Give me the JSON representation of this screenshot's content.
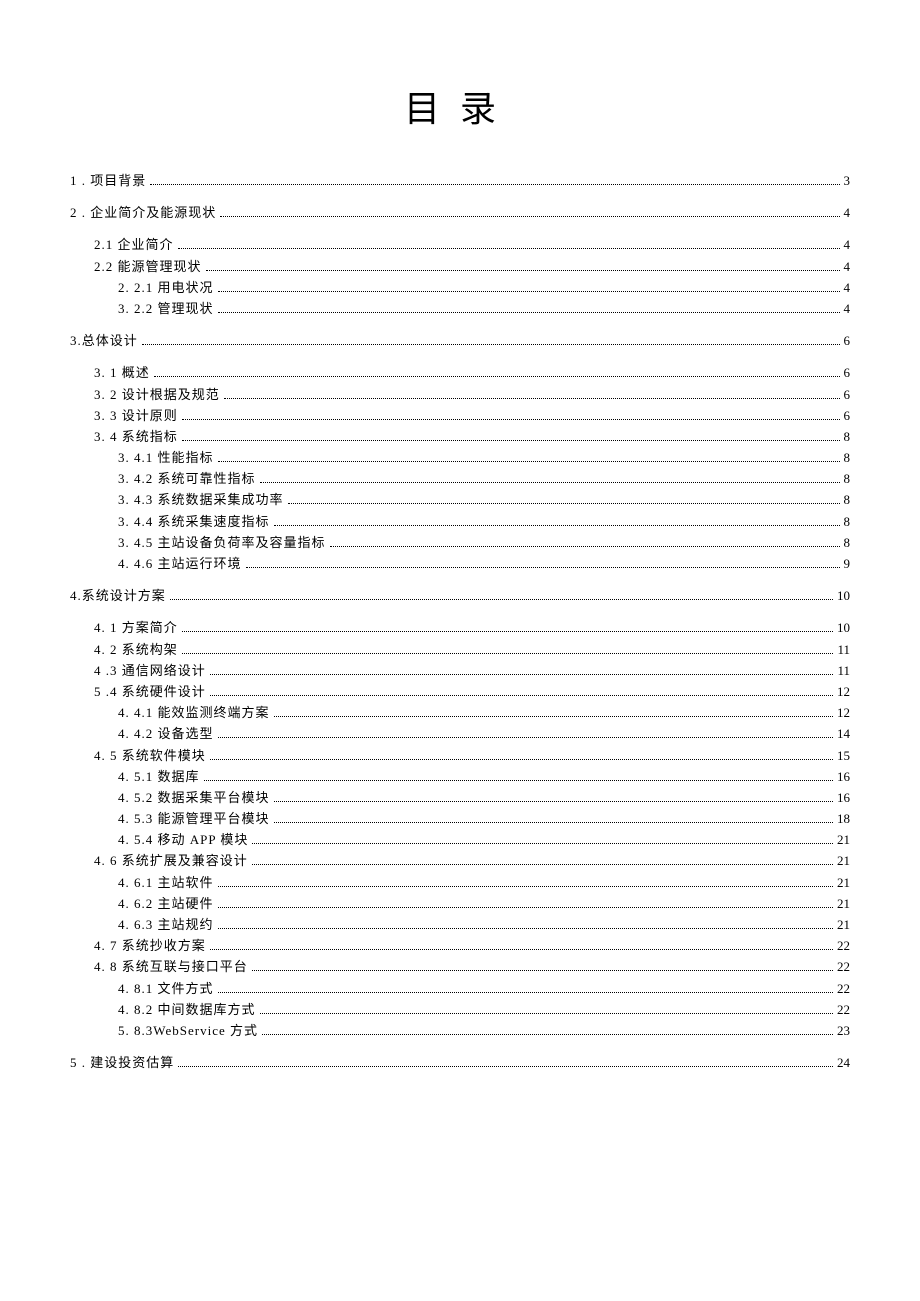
{
  "title": "目录",
  "entries": [
    {
      "level": 1,
      "label": "1   . 项目背景",
      "page": "3"
    },
    {
      "level": 1,
      "label": "2   . 企业简介及能源现状",
      "page": "4"
    },
    {
      "level": 2,
      "label": "2.1 企业简介",
      "page": "4"
    },
    {
      "level": 2,
      "label": "2.2 能源管理现状",
      "page": "4"
    },
    {
      "level": 3,
      "label": "2.    2.1 用电状况",
      "page": "4"
    },
    {
      "level": 3,
      "label": "3.    2.2 管理现状",
      "page": "4"
    },
    {
      "level": 1,
      "label": "3.总体设计",
      "page": "6"
    },
    {
      "level": 2,
      "label": "3.    1 概述",
      "page": "6"
    },
    {
      "level": 2,
      "label": "3.    2 设计根据及规范",
      "page": "6"
    },
    {
      "level": 2,
      "label": "3.    3 设计原则",
      "page": "6"
    },
    {
      "level": 2,
      "label": "3.    4 系统指标",
      "page": "8"
    },
    {
      "level": 3,
      "label": "3.    4.1 性能指标",
      "page": "8"
    },
    {
      "level": 3,
      "label": "3.    4.2 系统可靠性指标",
      "page": "8"
    },
    {
      "level": 3,
      "label": "3.    4.3 系统数据采集成功率",
      "page": "8"
    },
    {
      "level": 3,
      "label": "3.    4.4 系统采集速度指标",
      "page": "8"
    },
    {
      "level": 3,
      "label": "3.    4.5 主站设备负荷率及容量指标",
      "page": "8"
    },
    {
      "level": 3,
      "label": "4.    4.6 主站运行环境",
      "page": "9"
    },
    {
      "level": 1,
      "label": "4.系统设计方案",
      "page": "10"
    },
    {
      "level": 2,
      "label": "4.    1 方案简介",
      "page": "10"
    },
    {
      "level": 2,
      "label": "4.    2 系统构架",
      "page": "11"
    },
    {
      "level": 2,
      "label": "4    .3 通信网络设计",
      "page": "11"
    },
    {
      "level": 2,
      "label": "5    .4 系统硬件设计",
      "page": "12"
    },
    {
      "level": 3,
      "label": "4.    4.1 能效监测终端方案",
      "page": "12"
    },
    {
      "level": 3,
      "label": "4.    4.2 设备选型",
      "page": "14"
    },
    {
      "level": 2,
      "label": "4.    5 系统软件模块",
      "page": "15"
    },
    {
      "level": 3,
      "label": "4.    5.1 数据库",
      "page": "16"
    },
    {
      "level": 3,
      "label": "4.    5.2 数据采集平台模块",
      "page": "16"
    },
    {
      "level": 3,
      "label": "4.    5.3 能源管理平台模块",
      "page": "18"
    },
    {
      "level": 3,
      "label": "4.    5.4 移动 APP 模块",
      "page": "21"
    },
    {
      "level": 2,
      "label": "4.    6 系统扩展及兼容设计",
      "page": "21"
    },
    {
      "level": 3,
      "label": "4.    6.1 主站软件",
      "page": "21"
    },
    {
      "level": 3,
      "label": "4.    6.2 主站硬件",
      "page": "21"
    },
    {
      "level": 3,
      "label": "4.    6.3 主站规约",
      "page": "21"
    },
    {
      "level": 2,
      "label": "4.    7 系统抄收方案",
      "page": "22"
    },
    {
      "level": 2,
      "label": "4.    8 系统互联与接口平台",
      "page": "22"
    },
    {
      "level": 3,
      "label": "4.    8.1 文件方式",
      "page": "22"
    },
    {
      "level": 3,
      "label": "4.    8.2 中间数据库方式",
      "page": "22"
    },
    {
      "level": 3,
      "label": "5.    8.3WebService 方式",
      "page": "23"
    },
    {
      "level": 1,
      "label": "5   . 建设投资估算",
      "page": "24"
    }
  ]
}
